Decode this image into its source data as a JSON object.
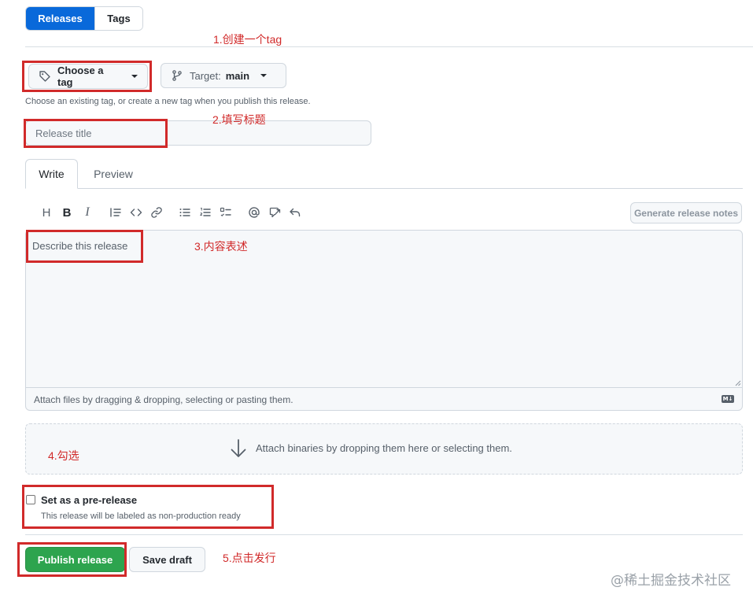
{
  "tabs": {
    "releases": "Releases",
    "tags": "Tags"
  },
  "tag_picker": {
    "label": "Choose a tag"
  },
  "target_picker": {
    "label": "Target:",
    "value": "main"
  },
  "tag_hint": "Choose an existing tag, or create a new tag when you publish this release.",
  "release_title": {
    "placeholder": "Release title"
  },
  "editor_tabs": {
    "write": "Write",
    "preview": "Preview"
  },
  "toolbar": {
    "icons": [
      "heading-icon",
      "bold-icon",
      "italic-icon",
      "quote-icon",
      "code-icon",
      "link-icon",
      "unordered-list-icon",
      "ordered-list-icon",
      "task-list-icon",
      "mention-icon",
      "reference-icon",
      "undo-icon"
    ],
    "generate_notes": "Generate release notes"
  },
  "description": {
    "placeholder": "Describe this release"
  },
  "attach_files": "Attach files by dragging & dropping, selecting or pasting them.",
  "markdown_badge": "M↓",
  "attach_binaries": "Attach binaries by dropping them here or selecting them.",
  "prerelease": {
    "label": "Set as a pre-release",
    "description": "This release will be labeled as non-production ready",
    "checked": false
  },
  "actions": {
    "publish": "Publish release",
    "save_draft": "Save draft"
  },
  "annotations": {
    "step1": "1.创建一个tag",
    "step2": "2.填写标题",
    "step3": "3.内容表述",
    "step4": "4.勾选",
    "step5": "5.点击发行",
    "color": "#d12a2a"
  },
  "watermark": "@稀土掘金技术社区",
  "colors": {
    "primary": "#0969da",
    "success": "#2da44e",
    "annotation": "#d12a2a"
  }
}
